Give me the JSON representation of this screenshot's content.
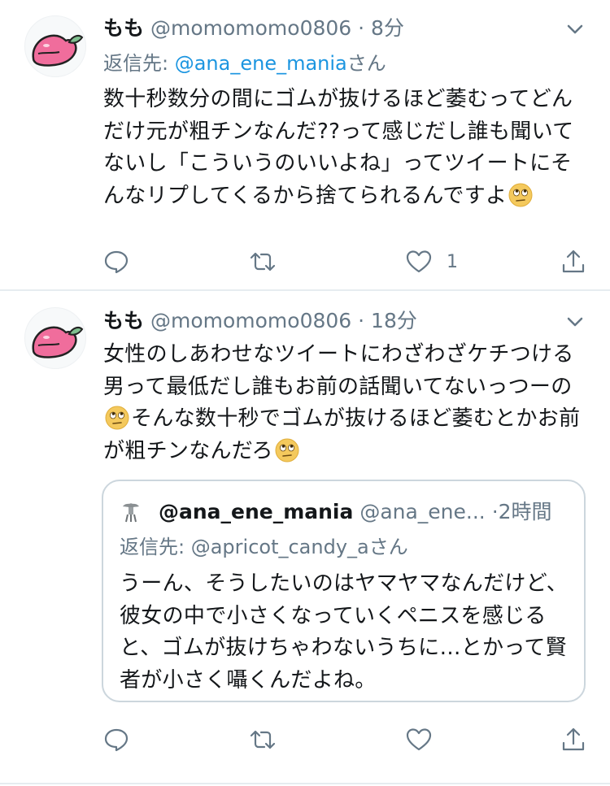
{
  "colors": {
    "link": "#1b95e0",
    "secondary_text": "#657786",
    "primary_text": "#14171a",
    "divider": "#e6ecf0",
    "quote_border": "#ccd6dd"
  },
  "tweets": [
    {
      "display_name": "もも",
      "handle": "@momomomo0806",
      "separator": "·",
      "time": "8分",
      "reply_prefix": "返信先: ",
      "reply_mention": "@ana_ene_mania",
      "reply_suffix": "さん",
      "text": "数十秒数分の間にゴムが抜けるほど萎むってどんだけ元が粗チンなんだ??って感じだし誰も聞いてないし「こういうのいいよね」ってツイートにそんなリプしてくるから捨てられるんですよ",
      "text_emoji": "face-with-rolling-eyes",
      "likes": "1",
      "icons": [
        "reply-icon",
        "retweet-icon",
        "like-icon",
        "share-icon"
      ]
    },
    {
      "display_name": "もも",
      "handle": "@momomomo0806",
      "separator": "·",
      "time": "18分",
      "text_part1": "女性のしあわせなツイートにわざわざケチつける男って最低だし誰もお前の話聞いてないっつーの",
      "text_part2": "そんな数十秒でゴムが抜けるほど萎むとかお前が粗チンなんだろ",
      "text_emoji": "face-with-rolling-eyes",
      "icons": [
        "reply-icon",
        "retweet-icon",
        "like-icon",
        "share-icon"
      ],
      "quote": {
        "display_name": "@ana_ene_mania",
        "handle": "@ana_ene...",
        "time": "·2時間",
        "reply_prefix": "返信先: ",
        "reply_mention": "@apricot_candy_a",
        "reply_suffix": "さん",
        "text": "うーん、そうしたいのはヤマヤマなんだけど、彼女の中で小さくなっていくペニスを感じると、ゴムが抜けちゃわないうちに…とかって賢者が小さく囁くんだよね。"
      }
    }
  ]
}
